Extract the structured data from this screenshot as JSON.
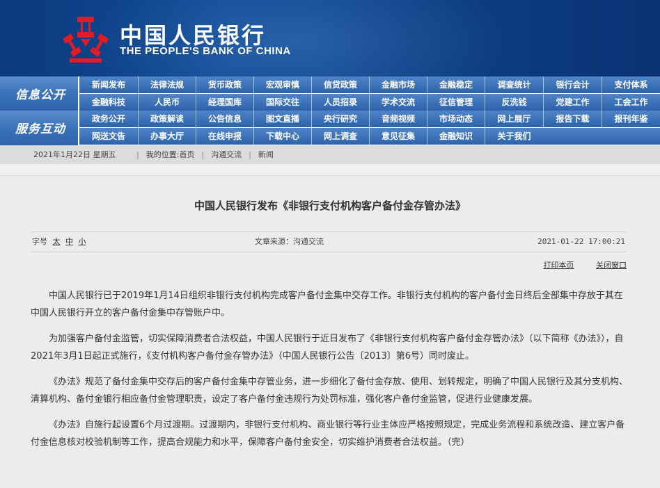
{
  "header": {
    "logo_cn": "中国人民银行",
    "logo_en": "THE PEOPLE'S BANK OF CHINA",
    "logo_icon": "pboc-emblem-icon"
  },
  "colors": {
    "header_blue": "#0c3f85",
    "nav_blue": "#2d62aa",
    "logo_red": "#e21c23"
  },
  "nav": {
    "info_label": "信息公开",
    "interact_label": "服务互动",
    "info_row1": [
      "新闻发布",
      "法律法规",
      "货币政策",
      "宏观审慎",
      "信贷政策",
      "金融市场",
      "金融稳定",
      "调查统计",
      "银行会计",
      "支付体系"
    ],
    "info_row2": [
      "金融科技",
      "人民币",
      "经理国库",
      "国际交往",
      "人员招录",
      "学术交流",
      "征信管理",
      "反洗钱",
      "党建工作",
      "工会工作"
    ],
    "interact_row1": [
      "政务公开",
      "政策解读",
      "公告信息",
      "图文直播",
      "央行研究",
      "音频视频",
      "市场动态",
      "网上展厅",
      "报告下载",
      "报刊年鉴"
    ],
    "interact_row2": [
      "网送文告",
      "办事大厅",
      "在线申报",
      "下载中心",
      "网上调查",
      "意见征集",
      "金融知识",
      "关于我们"
    ]
  },
  "breadcrumb": {
    "date": "2021年1月22日 星期五",
    "location_label": "我的位置:",
    "items": [
      "首页",
      "沟通交流",
      "新闻"
    ]
  },
  "article": {
    "title": "中国人民银行发布《非银行支付机构客户备付金存管办法》",
    "font_size_label": "字号",
    "font_sizes": [
      "太",
      "中",
      "小"
    ],
    "source": "文章来源：沟通交流",
    "timestamp": "2021-01-22 17:00:21",
    "print_label": "打印本页",
    "close_label": "关闭窗口",
    "paragraphs": [
      "中国人民银行已于2019年1月14日组织非银行支付机构完成客户备付金集中交存工作。非银行支付机构的客户备付金日终后全部集中存放于其在中国人民银行开立的客户备付金集中存管账户中。",
      "为加强客户备付金监管，切实保障消费者合法权益，中国人民银行于近日发布了《非银行支付机构客户备付金存管办法》（以下简称《办法》），自2021年3月1日起正式施行，《支付机构客户备付金存管办法》（中国人民银行公告〔2013〕第6号）同时废止。",
      "《办法》规范了备付金集中交存后的客户备付金集中存管业务，进一步细化了备付金存放、使用、划转规定，明确了中国人民银行及其分支机构、清算机构、备付金银行相应备付金管理职责，设定了客户备付金违规行为处罚标准，强化客户备付金监管，促进行业健康发展。",
      "《办法》自施行起设置6个月过渡期。过渡期内，非银行支付机构、商业银行等行业主体应严格按照规定，完成业务流程和系统改造、建立客户备付金信息核对校验机制等工作，提高合规能力和水平，保障客户备付金安全，切实维护消费者合法权益。（完）"
    ]
  }
}
